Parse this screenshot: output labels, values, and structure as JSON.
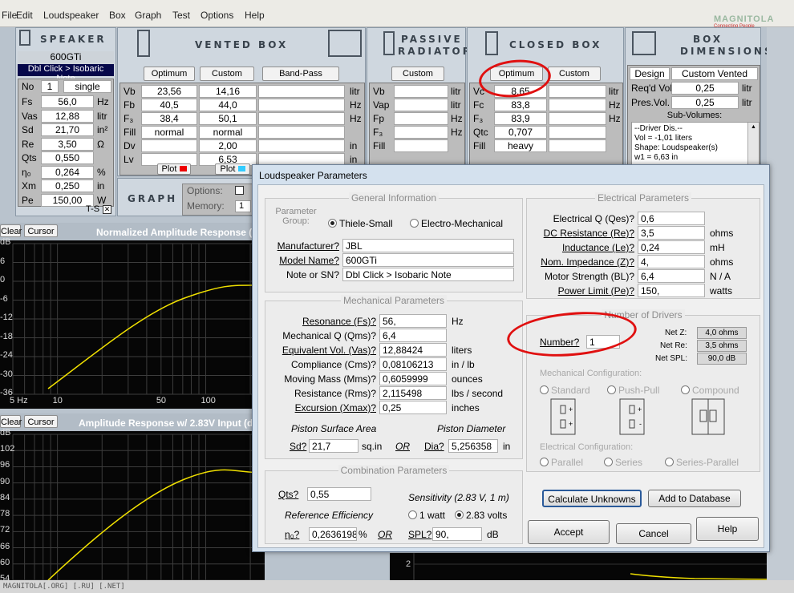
{
  "menu": [
    "File",
    "Edit",
    "Loudspeaker",
    "Box",
    "Graph",
    "Test",
    "Options",
    "Help"
  ],
  "watermark": {
    "main": "MAGNITOLA",
    "sub": "Connecting People"
  },
  "speaker": {
    "title": "SPEAKER",
    "model": "600GTi",
    "note": "Dbl Click > Isobaric Note",
    "no_label": "No",
    "no_value": "1",
    "mode": "single",
    "rows": [
      {
        "p": "Fs",
        "v": "56,0",
        "u": "Hz"
      },
      {
        "p": "Vas",
        "v": "12,88",
        "u": "litr"
      },
      {
        "p": "Sd",
        "v": "21,70",
        "u": "in²"
      },
      {
        "p": "Re",
        "v": "3,50",
        "u": "Ω"
      },
      {
        "p": "Qts",
        "v": "0,550",
        "u": ""
      },
      {
        "p": "η₀",
        "v": "0,264",
        "u": "%"
      },
      {
        "p": "Xm",
        "v": "0,250",
        "u": "in"
      },
      {
        "p": "Pe",
        "v": "150,00",
        "u": "W"
      }
    ],
    "ts": "T-S"
  },
  "vented": {
    "title": "VENTED BOX",
    "optimum": "Optimum",
    "custom": "Custom",
    "bandpass": "Band-Pass",
    "rows": [
      {
        "p": "Vb",
        "o": "23,56",
        "c": "14,16",
        "u": "litr"
      },
      {
        "p": "Fb",
        "o": "40,5",
        "c": "44,0",
        "u": "Hz"
      },
      {
        "p": "F₃",
        "o": "38,4",
        "c": "50,1",
        "u": "Hz"
      },
      {
        "p": "Fill",
        "o": "normal",
        "c": "normal",
        "u": ""
      },
      {
        "p": "Dv",
        "o": "",
        "c": "2,00",
        "u": "in"
      },
      {
        "p": "Lv",
        "o": "",
        "c": "6,53",
        "u": "in"
      }
    ],
    "plot": "Plot"
  },
  "passive": {
    "title1": "PASSIVE",
    "title2": "RADIATOR",
    "custom": "Custom",
    "rows": [
      {
        "p": "Vb",
        "u": "litr"
      },
      {
        "p": "Vap",
        "u": "litr"
      },
      {
        "p": "Fp",
        "u": "Hz"
      },
      {
        "p": "F₃",
        "u": "Hz"
      },
      {
        "p": "Fill",
        "u": ""
      }
    ]
  },
  "closed": {
    "title": "CLOSED BOX",
    "optimum": "Optimum",
    "custom": "Custom",
    "rows": [
      {
        "p": "Vc",
        "o": "8,65",
        "u": "litr"
      },
      {
        "p": "Fc",
        "o": "83,8",
        "u": "Hz"
      },
      {
        "p": "F₃",
        "o": "83,9",
        "u": "Hz"
      },
      {
        "p": "Qtc",
        "o": "0,707",
        "u": ""
      },
      {
        "p": "Fill",
        "o": "heavy",
        "u": ""
      }
    ]
  },
  "boxdim": {
    "title1": "BOX",
    "title2": "DIMENSIONS",
    "design": "Design",
    "design_val": "Custom Vented",
    "req_label": "Req'd Vol.",
    "req_val": "0,25",
    "req_u": "litr",
    "pres_label": "Pres.Vol.",
    "pres_val": "0,25",
    "pres_u": "litr",
    "subvol": "Sub-Volumes:",
    "subvol_lines": [
      "--Driver Dis.--",
      "Vol = -1,01 liters",
      "Shape: Loudspeaker(s)",
      "w1 = 6,63 in"
    ]
  },
  "graphpanel": {
    "title": "GRAPH",
    "options": "Options:",
    "memory": "Memory:",
    "memory_val": "1"
  },
  "graph1": {
    "clear": "Clear",
    "cursor": "Cursor",
    "title": "Normalized Amplitude Response (",
    "ylabels": [
      "dB",
      "6",
      "0",
      "-6",
      "-12",
      "-18",
      "-24",
      "-30",
      "-36"
    ],
    "xlabels": [
      "5 Hz",
      "10",
      "50",
      "100"
    ]
  },
  "graph2": {
    "clear": "Clear",
    "cursor": "Cursor",
    "title": "Amplitude Response w/ 2.83V Input (d",
    "ylabels": [
      "dB",
      "102",
      "96",
      "90",
      "84",
      "78",
      "72",
      "66",
      "60",
      "54"
    ],
    "bottom_tick": "2"
  },
  "dialog": {
    "title": "Loudspeaker Parameters",
    "general": {
      "cap": "General Information",
      "group_label1": "Parameter",
      "group_label2": "Group:",
      "ts": "Thiele-Small",
      "em": "Electro-Mechanical",
      "fields": [
        {
          "l": "Manufacturer?",
          "v": "JBL",
          "ul": true
        },
        {
          "l": "Model Name?",
          "v": "600GTi",
          "ul": true
        },
        {
          "l": "Note or SN?",
          "v": "Dbl Click > Isobaric Note",
          "ul": false
        }
      ]
    },
    "mech": {
      "cap": "Mechanical Parameters",
      "fields": [
        {
          "l": "Resonance (Fs)?",
          "v": "56,",
          "u": "Hz",
          "ul": true
        },
        {
          "l": "Mechanical Q (Qms)?",
          "v": "6,4",
          "u": "",
          "ul": false
        },
        {
          "l": "Equivalent Vol. (Vas)?",
          "v": "12,88424",
          "u": "liters",
          "ul": true
        },
        {
          "l": "Compliance (Cms)?",
          "v": "0,08106213",
          "u": "in / lb",
          "ul": false
        },
        {
          "l": "Moving Mass (Mms)?",
          "v": "0,6059999",
          "u": "ounces",
          "ul": false
        },
        {
          "l": "Resistance (Rms)?",
          "v": "2,115498",
          "u": "lbs / second",
          "ul": false
        },
        {
          "l": "Excursion (Xmax)?",
          "v": "0,25",
          "u": "inches",
          "ul": true
        }
      ],
      "piston_area": "Piston Surface Area",
      "piston_dia": "Piston Diameter",
      "sd_label": "Sd?",
      "sd_val": "21,7",
      "sd_u": "sq.in",
      "or": "OR",
      "dia_label": "Dia?",
      "dia_val": "5,256358",
      "dia_u": "in"
    },
    "combo": {
      "cap": "Combination Parameters",
      "qts_label": "Qts?",
      "qts_val": "0,55",
      "sens": "Sensitivity (2.83 V, 1 m)",
      "refeff": "Reference Efficiency",
      "w1": "1 watt",
      "v283": "2.83 volts",
      "n0_label": "η₀?",
      "n0_val": "0,2636198",
      "pct": "%",
      "or": "OR",
      "spl_label": "SPL?",
      "spl_val": "90,",
      "db": "dB"
    },
    "elec": {
      "cap": "Electrical Parameters",
      "fields": [
        {
          "l": "Electrical Q (Qes)?",
          "v": "0,6",
          "u": "",
          "ul": false
        },
        {
          "l": "DC Resistance (Re)?",
          "v": "3,5",
          "u": "ohms",
          "ul": true
        },
        {
          "l": "Inductance (Le)?",
          "v": "0,24",
          "u": "mH",
          "ul": true
        },
        {
          "l": "Nom. Impedance (Z)?",
          "v": "4,",
          "u": "ohms",
          "ul": true
        },
        {
          "l": "Motor Strength (BL)?",
          "v": "6,4",
          "u": "N / A",
          "ul": false
        },
        {
          "l": "Power Limit (Pe)?",
          "v": "150,",
          "u": "watts",
          "ul": true
        }
      ]
    },
    "drivers": {
      "cap": "Number of Drivers",
      "number_label": "Number?",
      "number_val": "1",
      "netz_l": "Net Z:",
      "netz_v": "4,0 ohms",
      "netre_l": "Net Re:",
      "netre_v": "3,5 ohms",
      "netspl_l": "Net SPL:",
      "netspl_v": "90,0 dB",
      "mech_cfg": "Mechanical Configuration:",
      "standard": "Standard",
      "pushpull": "Push-Pull",
      "compound": "Compound",
      "elec_cfg": "Electrical Configuration:",
      "parallel": "Parallel",
      "series": "Series",
      "seriesparallel": "Series-Parallel"
    },
    "buttons": {
      "calc": "Calculate Unknowns",
      "add": "Add to Database",
      "accept": "Accept",
      "cancel": "Cancel",
      "help": "Help"
    }
  },
  "status": "MAGNITOLA[.ORG] [.RU] [.NET]"
}
